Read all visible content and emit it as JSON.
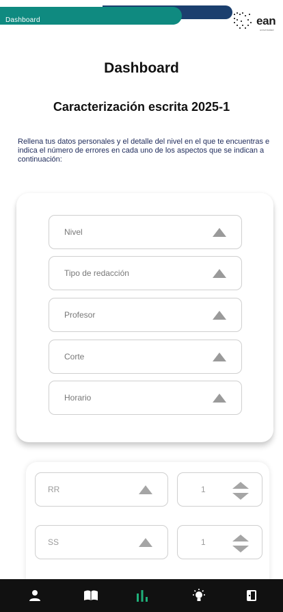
{
  "header": {
    "tab_label": "Dashboard",
    "brand_name": "ean",
    "brand_sub": "universidad"
  },
  "page_title": "Dashboard",
  "section_title": "Caracterización escrita 2025-1",
  "instructions": "Rellena tus datos personales y el detalle del nivel en el que te encuentras e indica el número de errores en cada uno de los aspectos que se indican a continuación:",
  "form": {
    "selects": [
      {
        "label": "Nivel"
      },
      {
        "label": "Tipo de redacción"
      },
      {
        "label": "Profesor"
      },
      {
        "label": "Corte"
      },
      {
        "label": "Horario"
      }
    ]
  },
  "errors": [
    {
      "label": "RR",
      "value": "1"
    },
    {
      "label": "SS",
      "value": "1"
    }
  ],
  "nav": {
    "items": [
      {
        "icon": "user-icon"
      },
      {
        "icon": "book-icon"
      },
      {
        "icon": "bar-chart-icon",
        "active": true
      },
      {
        "icon": "lightbulb-icon"
      },
      {
        "icon": "logout-icon"
      }
    ]
  },
  "colors": {
    "header_green": "#0f8a80",
    "header_blue": "#1b3f6e",
    "nav_background": "#111111",
    "nav_active": "#1fb07a",
    "instructions_text": "#1d2a5a"
  }
}
